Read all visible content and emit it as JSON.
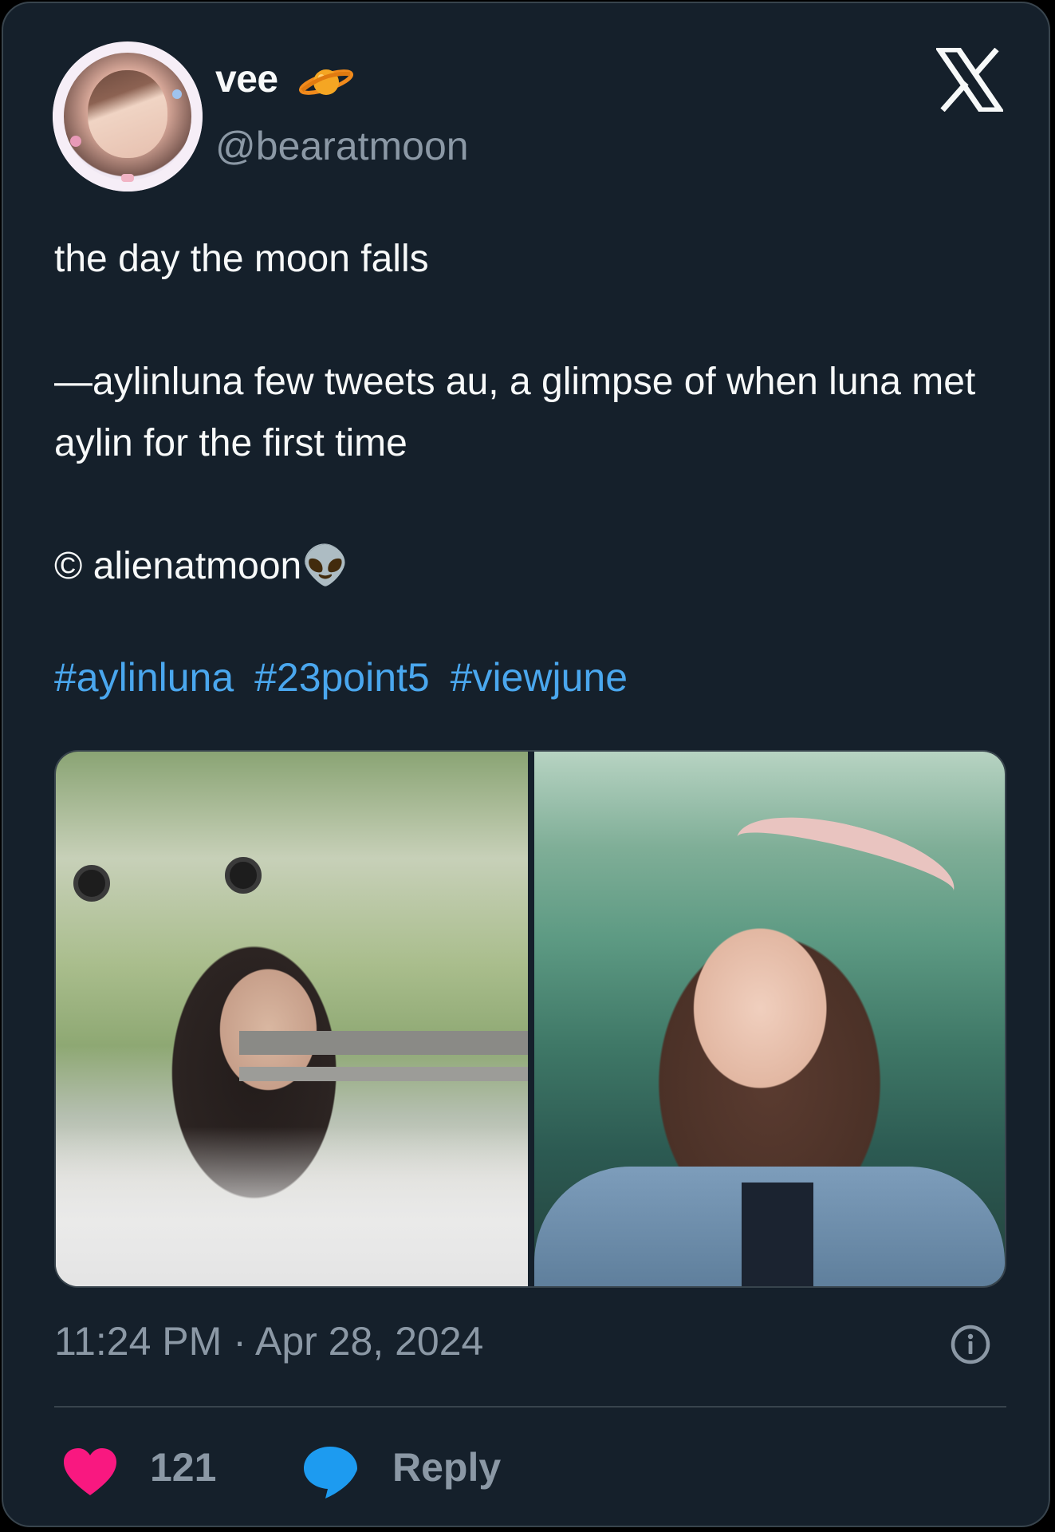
{
  "author": {
    "display_name": "vee",
    "handle": "@bearatmoon",
    "badge_emoji_icon": "ringed-planet-icon"
  },
  "tweet": {
    "text": "the day the moon falls\n\n—aylinluna few tweets au, a glimpse of when luna met aylin for the first time\n\n© alienatmoon👽",
    "hashtags": [
      "#aylinluna",
      "#23point5",
      "#viewjune"
    ],
    "timestamp": "11:24 PM · Apr 28, 2024"
  },
  "actions": {
    "like_count": "121",
    "reply_label": "Reply"
  },
  "colors": {
    "background": "#15202b",
    "text": "#f7f9f9",
    "secondary_text": "#8b98a5",
    "link": "#4aa7ee",
    "like": "#f91880",
    "reply": "#1d9bf0"
  }
}
